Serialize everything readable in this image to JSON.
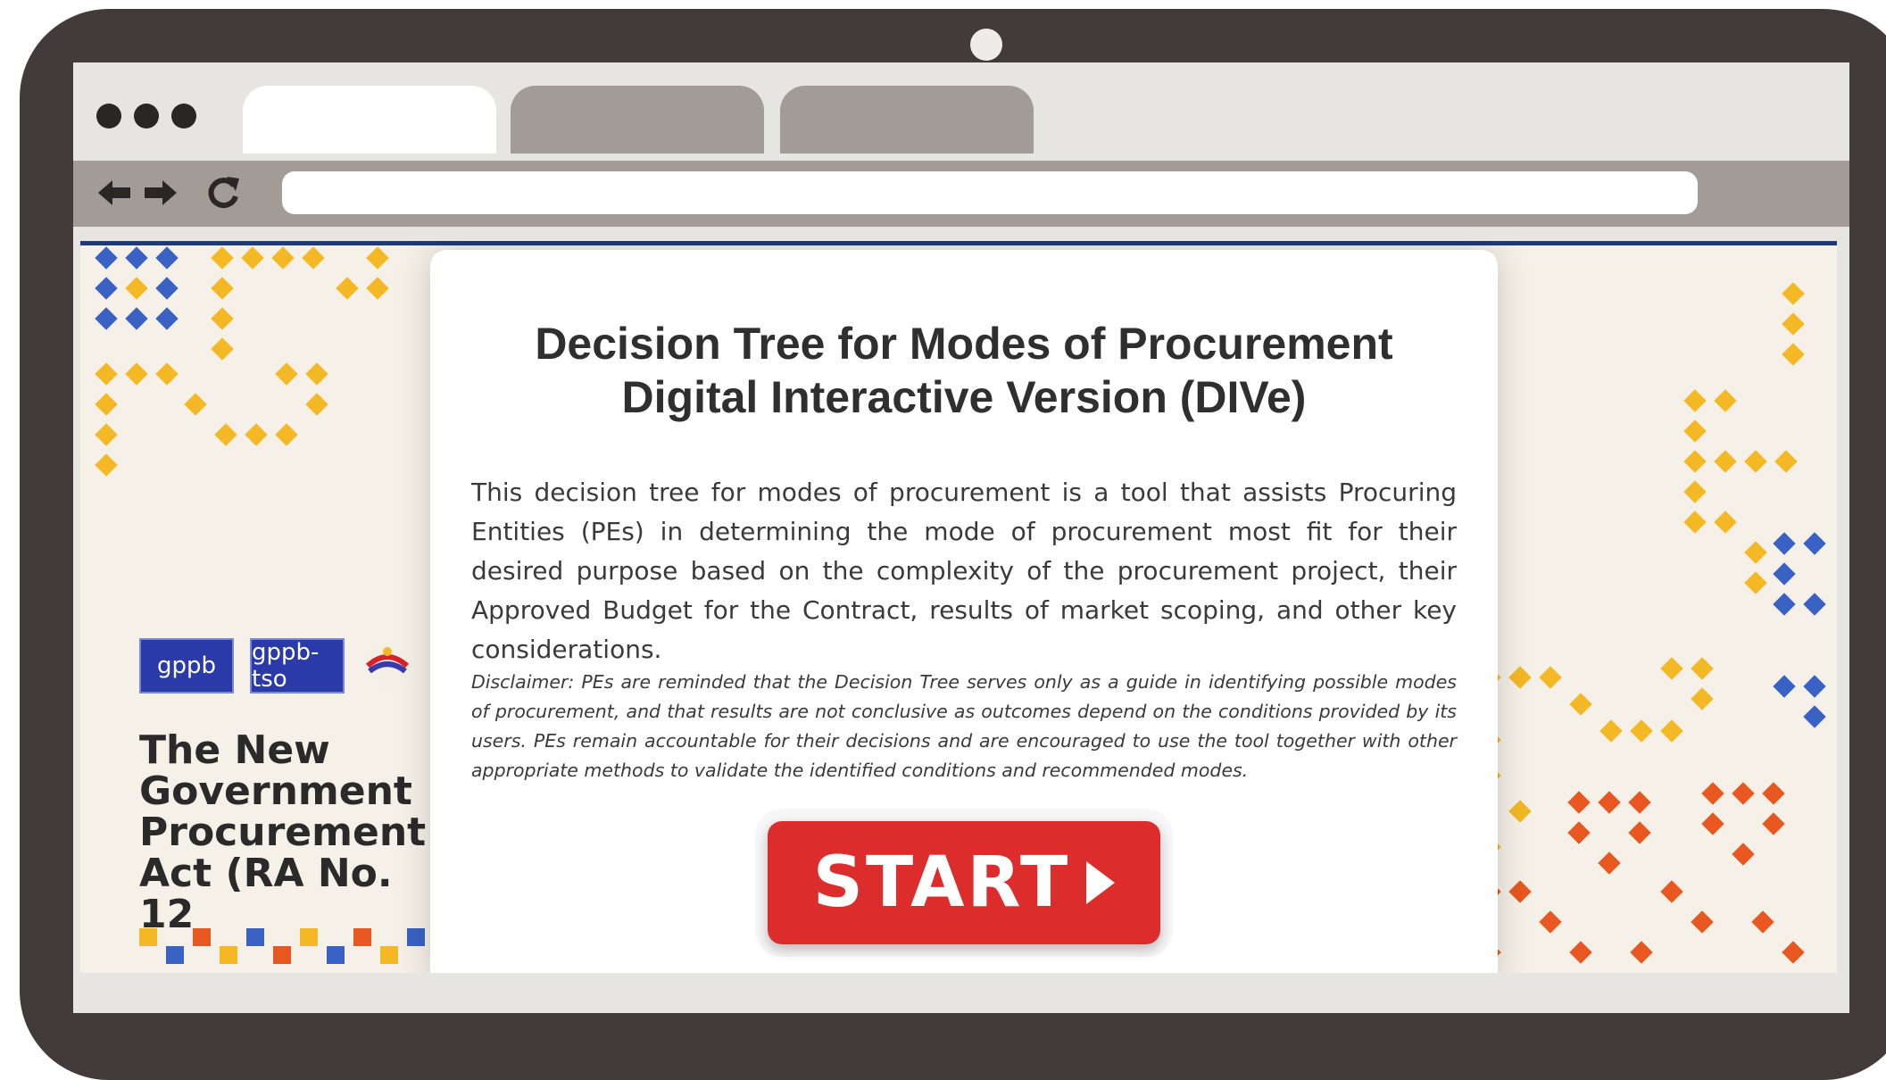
{
  "browser": {
    "tabs": [
      {
        "label": "",
        "active": true
      },
      {
        "label": "",
        "active": false
      },
      {
        "label": "",
        "active": false
      }
    ],
    "address_bar": {
      "value": ""
    },
    "icons": [
      "back-arrow-icon",
      "forward-arrow-icon",
      "reload-icon"
    ]
  },
  "left_panel": {
    "logos": {
      "gppb": "gppb",
      "gppb_tso": "gppb-tso"
    },
    "title": "The New Government Procurement Act (RA No. 12"
  },
  "card": {
    "title_line1": "Decision Tree for Modes of Procurement",
    "title_line2": "Digital Interactive Version (DIVe)",
    "description": "This decision tree for modes of procurement is a tool that assists Procuring Entities (PEs) in determining the mode of procurement most fit for their desired purpose based on the complexity of the procurement project, their Approved Budget for the Contract, results of market scoping, and other key considerations.",
    "disclaimer": "Disclaimer: PEs are reminded that the Decision Tree serves only as a guide in identifying possible modes of procurement, and that results are not conclusive as outcomes depend on the conditions provided by its users. PEs remain accountable for their decisions and are encouraged to use the tool together with other appropriate methods to validate the identified conditions and recommended modes.",
    "start_label": "START"
  },
  "colors": {
    "frame": "#433b3a",
    "browser_chrome": "#a39b96",
    "start_button": "#dc2c2b",
    "accent_yellow": "#f4b824",
    "accent_blue": "#3a62c4",
    "accent_orange": "#e8571f"
  }
}
